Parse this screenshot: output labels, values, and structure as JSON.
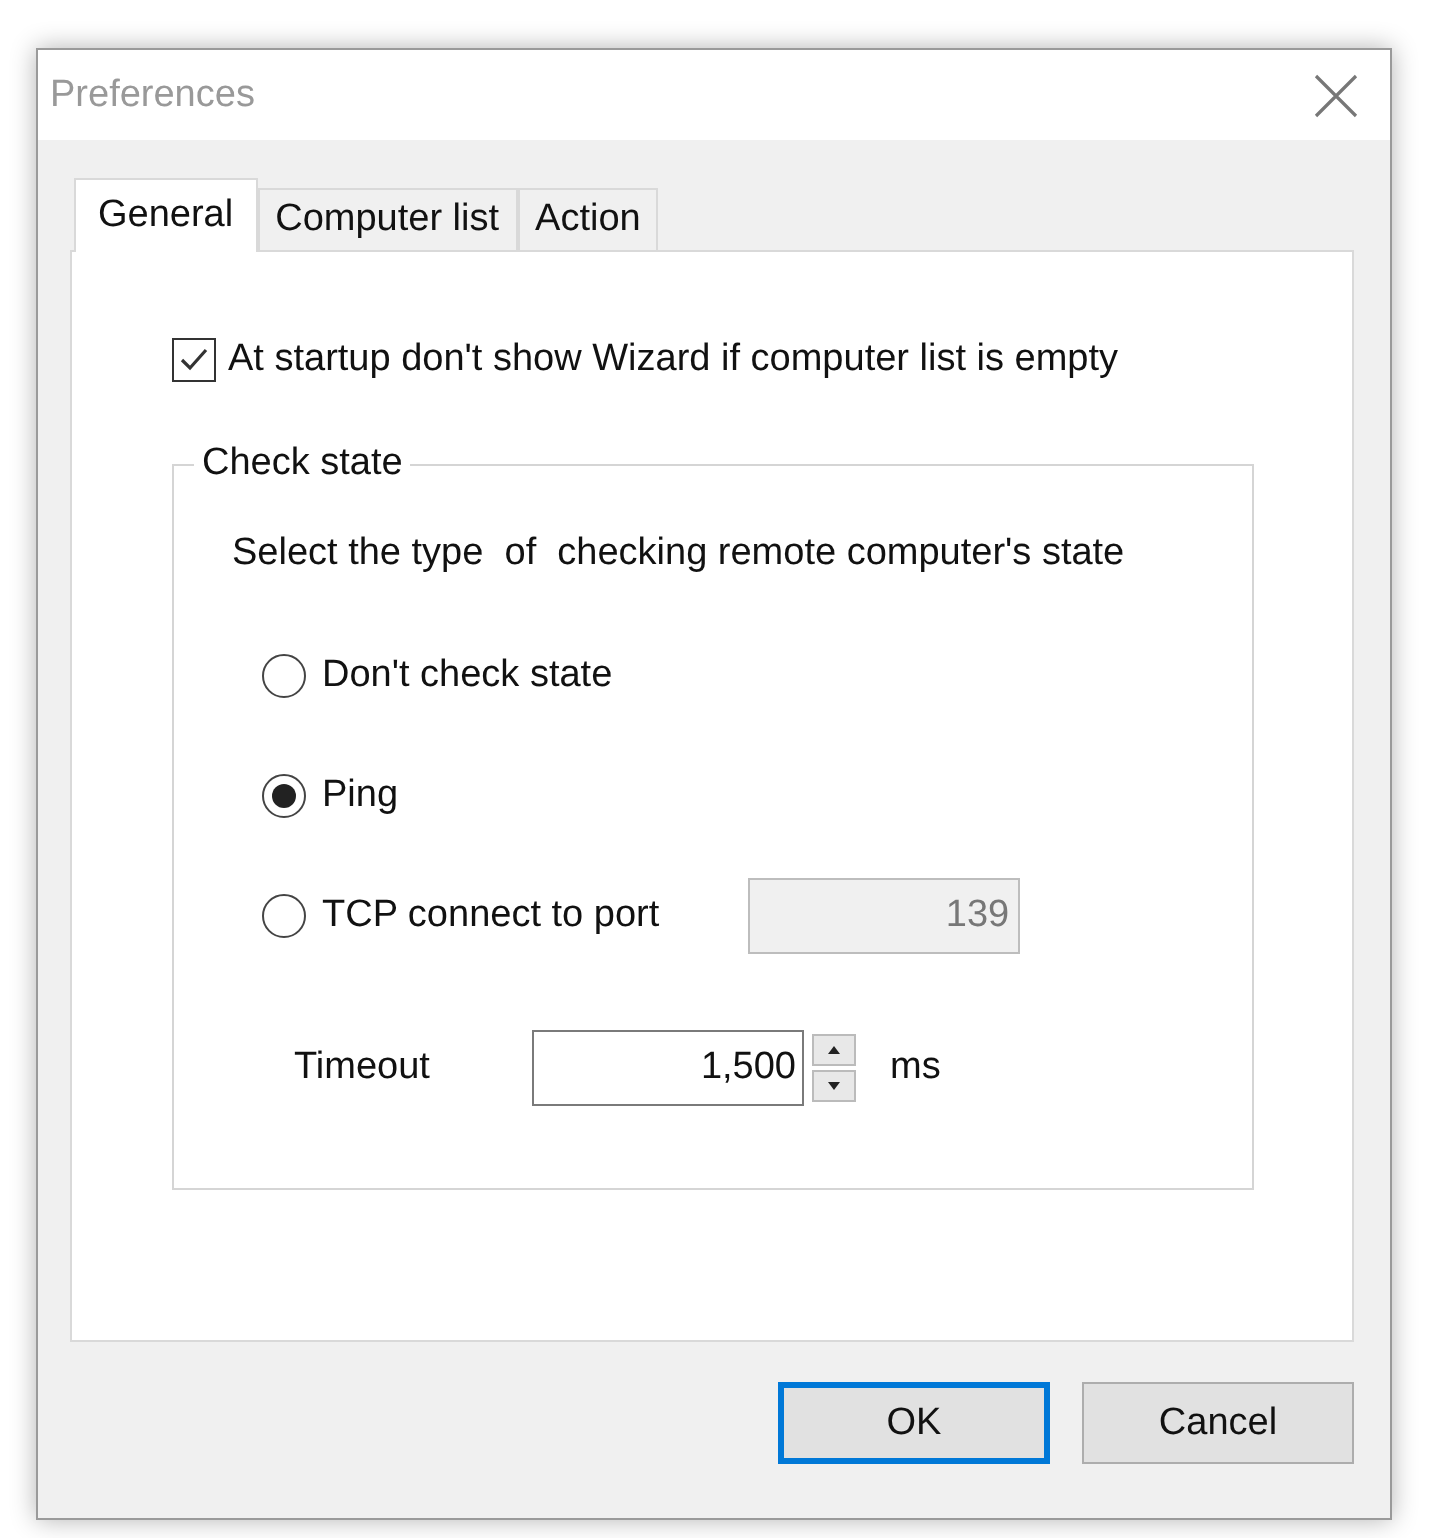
{
  "window": {
    "title": "Preferences"
  },
  "tabs": [
    {
      "label": "General",
      "selected": true
    },
    {
      "label": "Computer list",
      "selected": false
    },
    {
      "label": "Action",
      "selected": false
    }
  ],
  "startup_checkbox": {
    "label": "At startup don't show Wizard if computer list is empty",
    "checked": true
  },
  "check_state": {
    "title": "Check state",
    "description": "Select the type  of  checking remote computer's state",
    "options": [
      {
        "label": "Don't check state",
        "selected": false
      },
      {
        "label": "Ping",
        "selected": true
      },
      {
        "label": "TCP connect to port",
        "selected": false
      }
    ],
    "port": {
      "value": "139",
      "disabled": true
    },
    "timeout": {
      "label": "Timeout",
      "value": "1,500",
      "unit": "ms"
    }
  },
  "buttons": [
    {
      "label": "OK",
      "default": true
    },
    {
      "label": "Cancel",
      "default": false
    }
  ]
}
